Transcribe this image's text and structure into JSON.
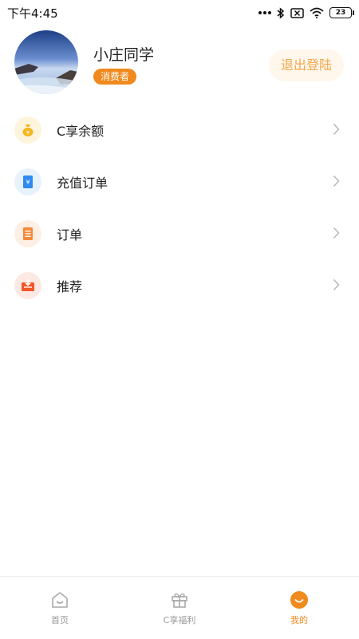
{
  "status_bar": {
    "time": "下午4:45",
    "battery": "23"
  },
  "profile": {
    "name": "小庄同学",
    "role": "消费者",
    "logout_label": "退出登陆"
  },
  "menu": [
    {
      "label": "C享余额",
      "icon": "money-bag-icon",
      "color": "#f5b51e"
    },
    {
      "label": "充值订单",
      "icon": "recharge-receipt-icon",
      "color": "#2f8bf0"
    },
    {
      "label": "订单",
      "icon": "order-list-icon",
      "color": "#f5893a"
    },
    {
      "label": "推荐",
      "icon": "recommend-inbox-icon",
      "color": "#f0572a"
    }
  ],
  "bottom_nav": [
    {
      "label": "首页",
      "icon": "home-icon",
      "active": false
    },
    {
      "label": "C享福利",
      "icon": "gift-icon",
      "active": false
    },
    {
      "label": "我的",
      "icon": "profile-smile-icon",
      "active": true
    }
  ],
  "colors": {
    "accent": "#f08a1e",
    "logout_text": "#f5a64a",
    "logout_bg": "#fff7ec"
  }
}
